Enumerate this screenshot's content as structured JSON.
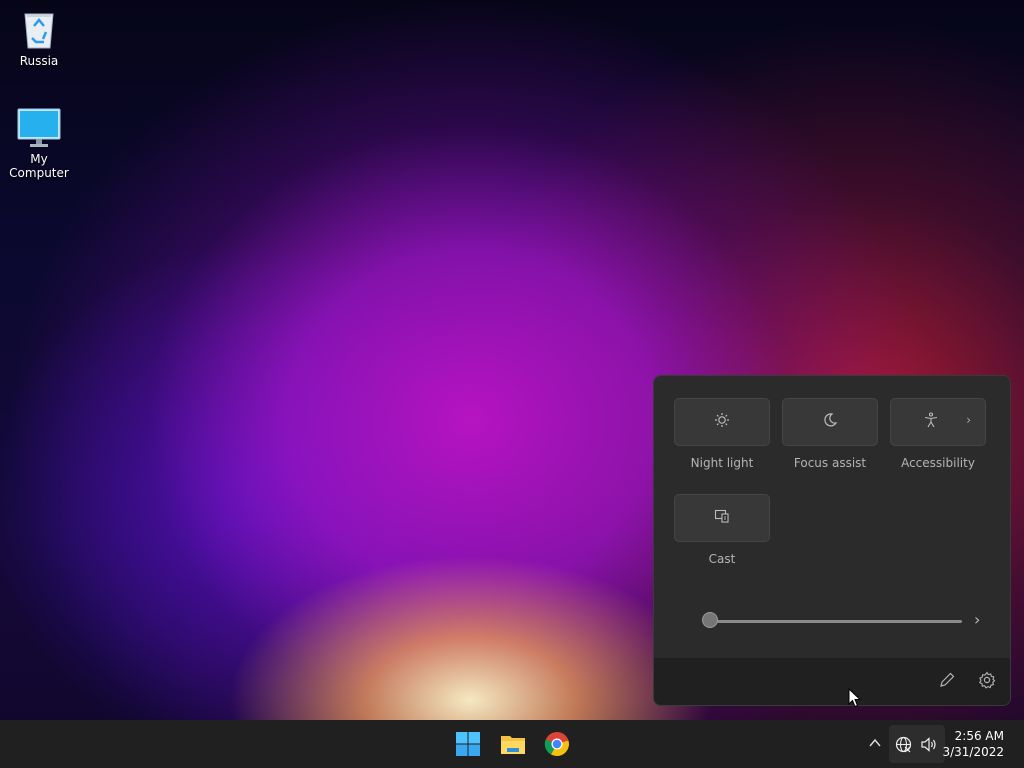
{
  "desktop": {
    "icons": [
      {
        "label": "Russia",
        "icon": "recycle-bin-icon"
      },
      {
        "label": "My Computer",
        "icon": "monitor-icon"
      }
    ]
  },
  "quick_settings": {
    "tiles": [
      {
        "label": "Night light",
        "icon": "brightness-icon"
      },
      {
        "label": "Focus assist",
        "icon": "moon-icon"
      },
      {
        "label": "Accessibility",
        "icon": "accessibility-icon"
      },
      {
        "label": "Cast",
        "icon": "cast-icon"
      }
    ],
    "slider": {
      "value": 0,
      "icon": "chevron-right-icon"
    },
    "footer": {
      "edit_icon": "pencil-icon",
      "settings_icon": "gear-icon"
    }
  },
  "taskbar": {
    "apps": [
      {
        "name": "start",
        "icon": "windows-start-icon"
      },
      {
        "name": "file-explorer",
        "icon": "folder-icon"
      },
      {
        "name": "chrome",
        "icon": "chrome-icon"
      }
    ],
    "tray": {
      "overflow_icon": "chevron-up-icon",
      "network_icon": "globe-icon",
      "volume_icon": "speaker-icon"
    },
    "clock": {
      "time": "2:56 AM",
      "date": "3/31/2022"
    }
  },
  "colors": {
    "taskbar": "#202020",
    "panel": "#2b2b2b",
    "tile": "#383838",
    "windows_blue": "#4cc2ff"
  }
}
